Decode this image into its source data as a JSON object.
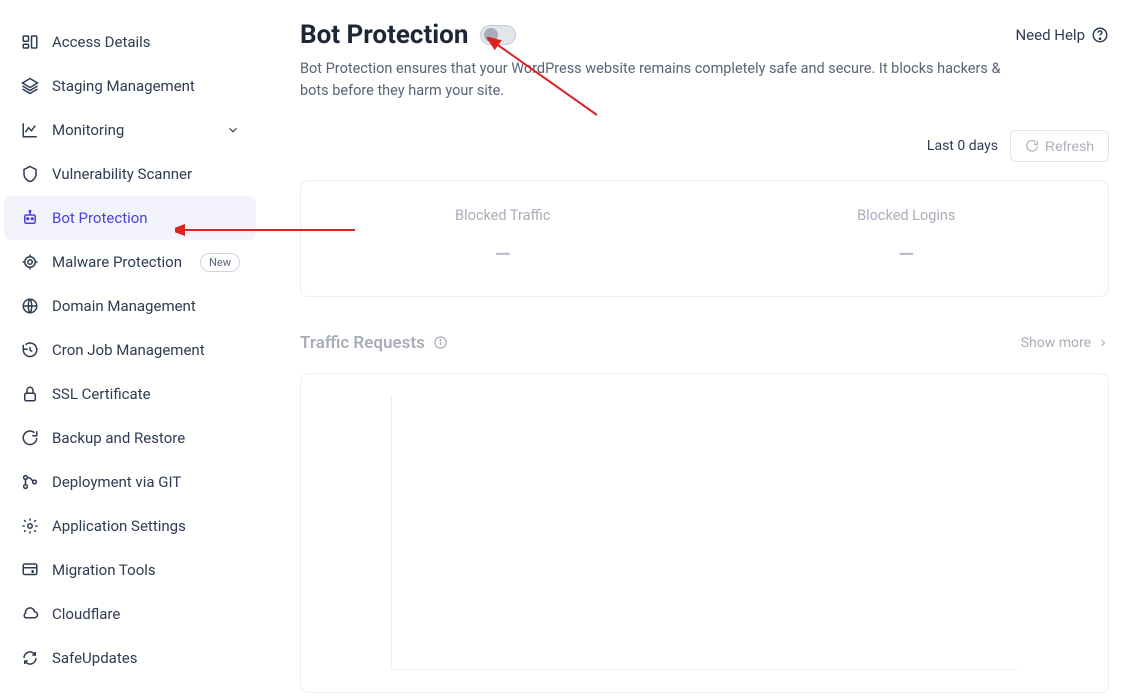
{
  "sidebar": {
    "items": [
      {
        "label": "Access Details",
        "icon": "access"
      },
      {
        "label": "Staging Management",
        "icon": "staging"
      },
      {
        "label": "Monitoring",
        "icon": "monitoring",
        "hasChevron": true
      },
      {
        "label": "Vulnerability Scanner",
        "icon": "shield"
      },
      {
        "label": "Bot Protection",
        "icon": "bot",
        "active": true
      },
      {
        "label": "Malware Protection",
        "icon": "malware",
        "badge": "New"
      },
      {
        "label": "Domain Management",
        "icon": "domain"
      },
      {
        "label": "Cron Job Management",
        "icon": "cron"
      },
      {
        "label": "SSL Certificate",
        "icon": "ssl"
      },
      {
        "label": "Backup and Restore",
        "icon": "backup"
      },
      {
        "label": "Deployment via GIT",
        "icon": "git"
      },
      {
        "label": "Application Settings",
        "icon": "settings"
      },
      {
        "label": "Migration Tools",
        "icon": "migration"
      },
      {
        "label": "Cloudflare",
        "icon": "cloud"
      },
      {
        "label": "SafeUpdates",
        "icon": "safeupdates"
      }
    ]
  },
  "header": {
    "title": "Bot Protection",
    "help": "Need Help"
  },
  "description": "Bot Protection ensures that your WordPress website remains completely safe and secure. It blocks hackers & bots before they harm your site.",
  "controls": {
    "lastDays": "Last 0 days",
    "refresh": "Refresh"
  },
  "stats": [
    {
      "label": "Blocked Traffic",
      "value": "—"
    },
    {
      "label": "Blocked Logins",
      "value": "—"
    }
  ],
  "traffic": {
    "title": "Traffic Requests",
    "showMore": "Show more"
  }
}
